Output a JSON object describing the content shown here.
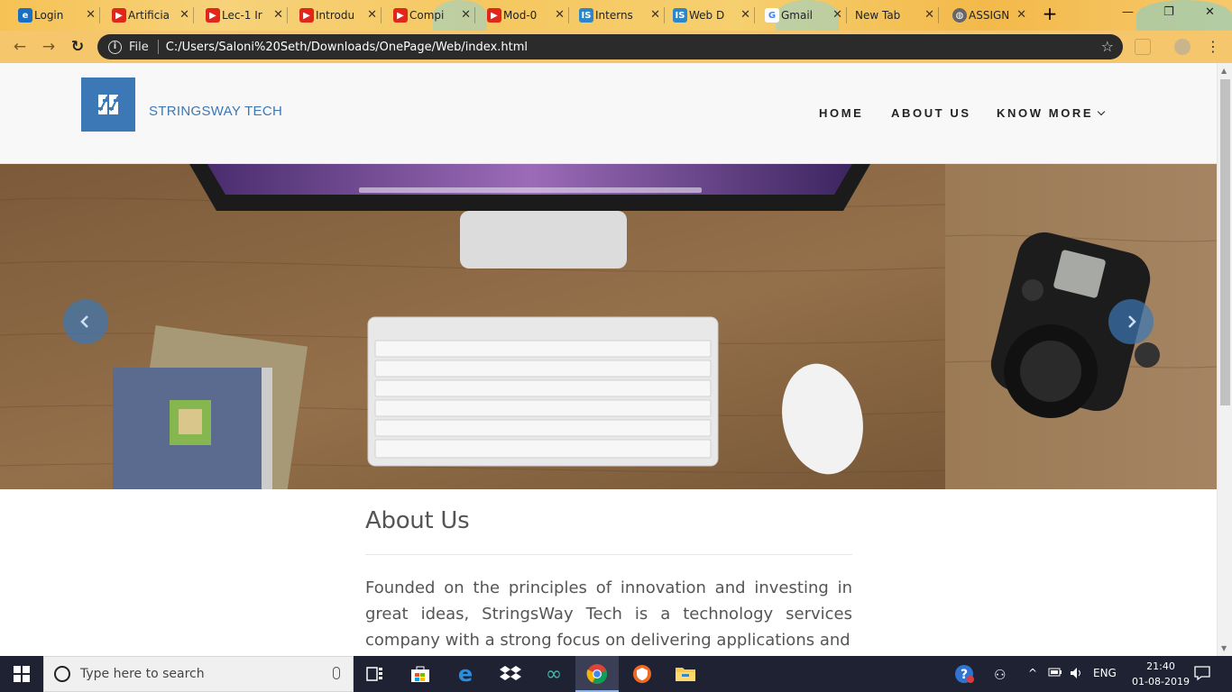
{
  "browser": {
    "tabs": [
      {
        "title": "Login",
        "icon": "edge-icon"
      },
      {
        "title": "Artificia",
        "icon": "youtube-icon"
      },
      {
        "title": "Lec-1 Ir",
        "icon": "youtube-icon"
      },
      {
        "title": "Introdu",
        "icon": "youtube-icon"
      },
      {
        "title": "Compi",
        "icon": "youtube-icon"
      },
      {
        "title": "Mod-0",
        "icon": "youtube-icon"
      },
      {
        "title": "Interns",
        "icon": "internshala-icon"
      },
      {
        "title": "Web D",
        "icon": "internshala-icon"
      },
      {
        "title": "Gmail",
        "icon": "google-icon"
      },
      {
        "title": "New Tab",
        "icon": "blank-icon"
      },
      {
        "title": "ASSIGN",
        "icon": "globe-icon"
      }
    ],
    "active_tab": 10,
    "address": {
      "scheme_label": "File",
      "url": "C:/Users/Saloni%20Seth/Downloads/OnePage/Web/index.html"
    }
  },
  "site": {
    "logo_letters": "SS",
    "brand": "STRINGSWAY TECH",
    "nav": [
      {
        "label": "HOME"
      },
      {
        "label": "ABOUT US"
      },
      {
        "label": "KNOW MORE"
      }
    ],
    "about": {
      "heading": "About Us",
      "text": "Founded on the principles of innovation and investing in great ideas, StringsWay Tech is a technology services company with a strong focus on delivering applications and"
    }
  },
  "taskbar": {
    "search_placeholder": "Type here to search",
    "language": "ENG",
    "time": "21:40",
    "date": "01-08-2019"
  },
  "colors": {
    "brand_blue": "#3c78b5",
    "tabstrip": "#f6c86a",
    "omnibox": "#2b2b2b",
    "taskbar": "#1f2233"
  }
}
